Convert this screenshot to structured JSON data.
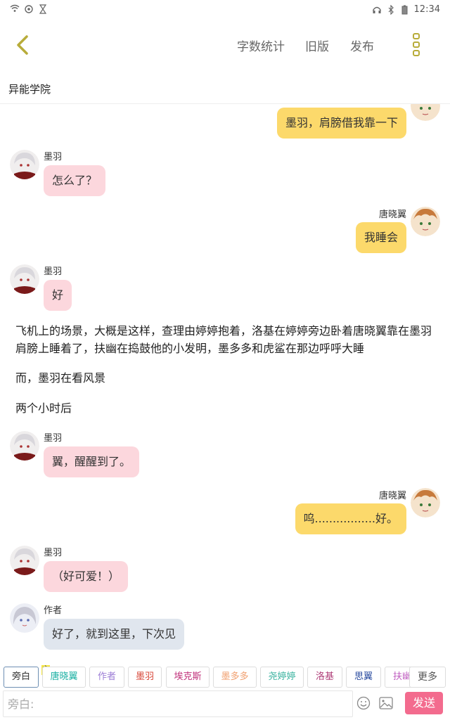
{
  "status_bar": {
    "time": "12:34",
    "left_icons": [
      "wifi-icon",
      "sync-icon",
      "hourglass-icon"
    ],
    "right_icons": [
      "headset-icon",
      "bluetooth-icon",
      "battery-icon"
    ]
  },
  "header": {
    "back_icon": "chevron-left-icon",
    "actions": [
      "字数统计",
      "旧版",
      "发布"
    ],
    "more_icon": "vertical-dots-icon",
    "accent_color": "#b8ac3a"
  },
  "story": {
    "title": "异能学院"
  },
  "messages": [
    {
      "speaker": "唐晓翼",
      "side": "right",
      "text": "墨羽，肩膀借我靠一下",
      "show_name": false
    },
    {
      "speaker": "墨羽",
      "side": "left",
      "text": "怎么了？"
    },
    {
      "speaker": "唐晓翼",
      "side": "right",
      "text": "我睡会"
    },
    {
      "speaker": "墨羽",
      "side": "left",
      "text": "好"
    },
    {
      "type": "narration",
      "text": "飞机上的场景，大概是这样，查理由婷婷抱着，洛基在婷婷旁边卧着唐晓翼靠在墨羽肩膀上睡着了，扶幽在捣鼓他的小发明，墨多多和虎鲨在那边呼呼大睡"
    },
    {
      "type": "narration",
      "text": "而，墨羽在看风景"
    },
    {
      "type": "narration",
      "text": "两个小时后"
    },
    {
      "speaker": "墨羽",
      "side": "left",
      "text": "翼，醒醒到了。"
    },
    {
      "speaker": "唐晓翼",
      "side": "right",
      "text": "呜.................好。"
    },
    {
      "speaker": "墨羽",
      "side": "left",
      "text": "（好可爱！）"
    },
    {
      "speaker": "作者",
      "side": "left",
      "text": "好了，就到这里，下次见"
    }
  ],
  "roles": {
    "items": [
      {
        "label": "旁白",
        "color": "#333333"
      },
      {
        "label": "唐晓翼",
        "color": "#1bb0a3"
      },
      {
        "label": "作者",
        "color": "#9c7dd6"
      },
      {
        "label": "墨羽",
        "color": "#d8493b"
      },
      {
        "label": "埃克斯",
        "color": "#c0307a"
      },
      {
        "label": "墨多多",
        "color": "#f0a070"
      },
      {
        "label": "尧婷婷",
        "color": "#3bb3a0"
      },
      {
        "label": "洛基",
        "color": "#b0407a"
      },
      {
        "label": "思翼",
        "color": "#2a4ca0"
      },
      {
        "label": "扶幽",
        "color": "#c060c0"
      }
    ],
    "host_badge": "主",
    "more_label": "更多"
  },
  "composer": {
    "placeholder": "旁白:",
    "emoji_icon": "emoji-icon",
    "image_icon": "image-icon",
    "send_label": "发送",
    "send_color": "#f36b8e"
  }
}
